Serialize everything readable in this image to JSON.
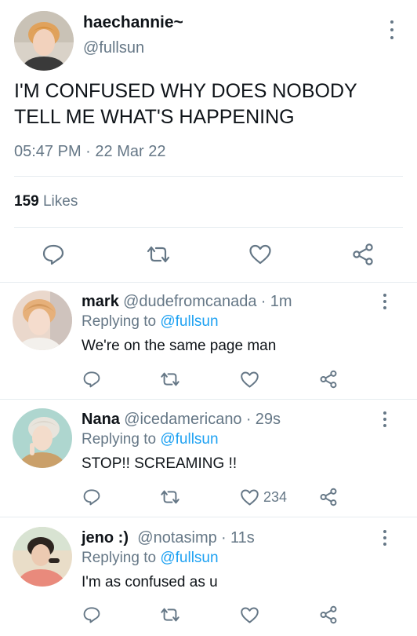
{
  "tweet": {
    "display_name": "haechannie~",
    "handle": "@fullsun",
    "text_line1": "I'M CONFUSED WHY DOES NOBODY",
    "text_line2": "TELL ME WHAT'S HAPPENING",
    "time": "05:47 PM",
    "separator": "·",
    "date": "22 Mar 22",
    "likes_count": "159",
    "likes_label": "Likes"
  },
  "replying_to_label": "Replying to",
  "replies": [
    {
      "name": "mark",
      "handle": "@dudefromcanada",
      "time": "1m",
      "replying_to": "@fullsun",
      "text": "We're on the same page man",
      "like_count": ""
    },
    {
      "name": "Nana",
      "handle": "@icedamericano",
      "time": "29s",
      "replying_to": "@fullsun",
      "text": "STOP!! SCREAMING !!",
      "like_count": "234"
    },
    {
      "name": "jeno :)",
      "handle": "@notasimp",
      "time": "11s",
      "replying_to": "@fullsun",
      "text": "I'm as confused as u",
      "like_count": ""
    }
  ],
  "icons": {
    "reply": "reply-icon",
    "retweet": "retweet-icon",
    "like": "heart-icon",
    "share": "share-icon",
    "more": "more-vertical-icon"
  },
  "colors": {
    "text": "#0f1419",
    "muted": "#657786",
    "link": "#1da1f2",
    "divider": "#e6ecf0"
  }
}
